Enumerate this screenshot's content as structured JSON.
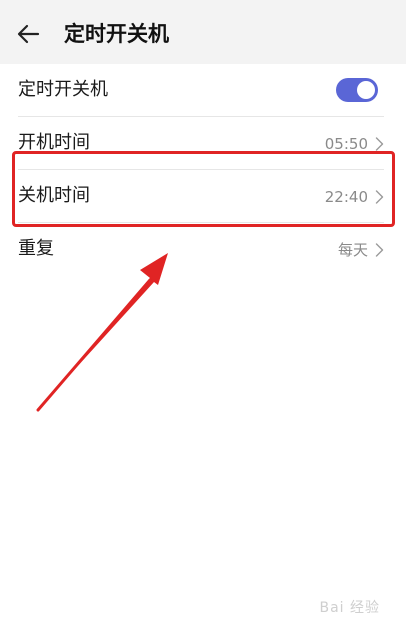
{
  "header": {
    "title": "定时开关机"
  },
  "settings": {
    "toggle_row": {
      "label": "定时开关机",
      "enabled": true
    },
    "power_on": {
      "label": "开机时间",
      "value": "05:50"
    },
    "power_off": {
      "label": "关机时间",
      "value": "22:40"
    },
    "repeat": {
      "label": "重复",
      "value": "每天"
    }
  },
  "colors": {
    "accent": "#5a66d6",
    "highlight": "#e02424",
    "header_bg": "#f3f3f3",
    "value_text": "#8a8a8a"
  },
  "watermark": "Bai 经验"
}
